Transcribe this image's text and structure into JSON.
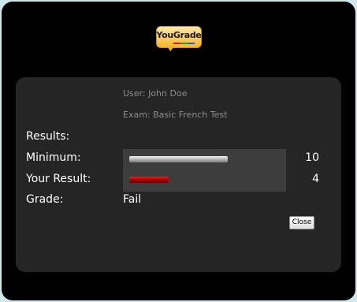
{
  "logo": {
    "text": "YouGrade",
    "stripe_colors": [
      "#d81b1b",
      "#2e9e2e",
      "#2a5fd0"
    ]
  },
  "info": {
    "user_line": "User: John Doe",
    "exam_line": "Exam: Basic French Test"
  },
  "results": {
    "heading": "Results:",
    "minimum_label": "Minimum:",
    "minimum_value": "10",
    "minimum_bar_fraction": 0.625,
    "your_result_label": "Your Result:",
    "your_result_value": "4",
    "your_result_bar_fraction": 0.25,
    "grade_label": "Grade:",
    "grade_value": "Fail"
  },
  "close_button": {
    "label": "Close"
  },
  "colors": {
    "minimum_bar": "#b0b0b0",
    "result_bar": "#b00000",
    "panel": "#252525",
    "background": "#000000"
  }
}
